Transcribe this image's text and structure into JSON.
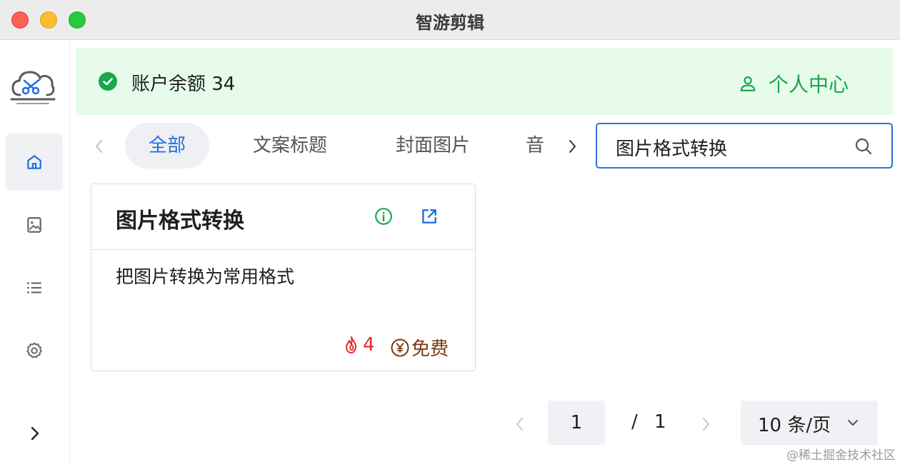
{
  "window": {
    "title": "智游剪辑"
  },
  "sidebar": {
    "items": [
      {
        "name": "home",
        "active": true
      },
      {
        "name": "image",
        "active": false
      },
      {
        "name": "list",
        "active": false
      },
      {
        "name": "settings",
        "active": false
      },
      {
        "name": "expand",
        "active": false
      }
    ]
  },
  "banner": {
    "balance_text": "账户余额 34",
    "profile_label": "个人中心"
  },
  "tabs": [
    {
      "label": "全部",
      "active": true
    },
    {
      "label": "文案标题",
      "active": false
    },
    {
      "label": "封面图片",
      "active": false
    },
    {
      "label": "音",
      "active": false
    }
  ],
  "search": {
    "value": "图片格式转换"
  },
  "card": {
    "title": "图片格式转换",
    "description": "把图片转换为常用格式",
    "hot_count": "4",
    "price_label": "免费"
  },
  "pagination": {
    "current": "1",
    "separator": "/",
    "total": "1",
    "page_size": "10 条/页"
  },
  "watermark": "@稀土掘金技术社区",
  "colors": {
    "accent_blue": "#1f6fe0",
    "success_green": "#1aa64a",
    "banner_bg": "#e6fbea",
    "hot_red": "#e02b25",
    "price_brown": "#7a3a0c"
  }
}
